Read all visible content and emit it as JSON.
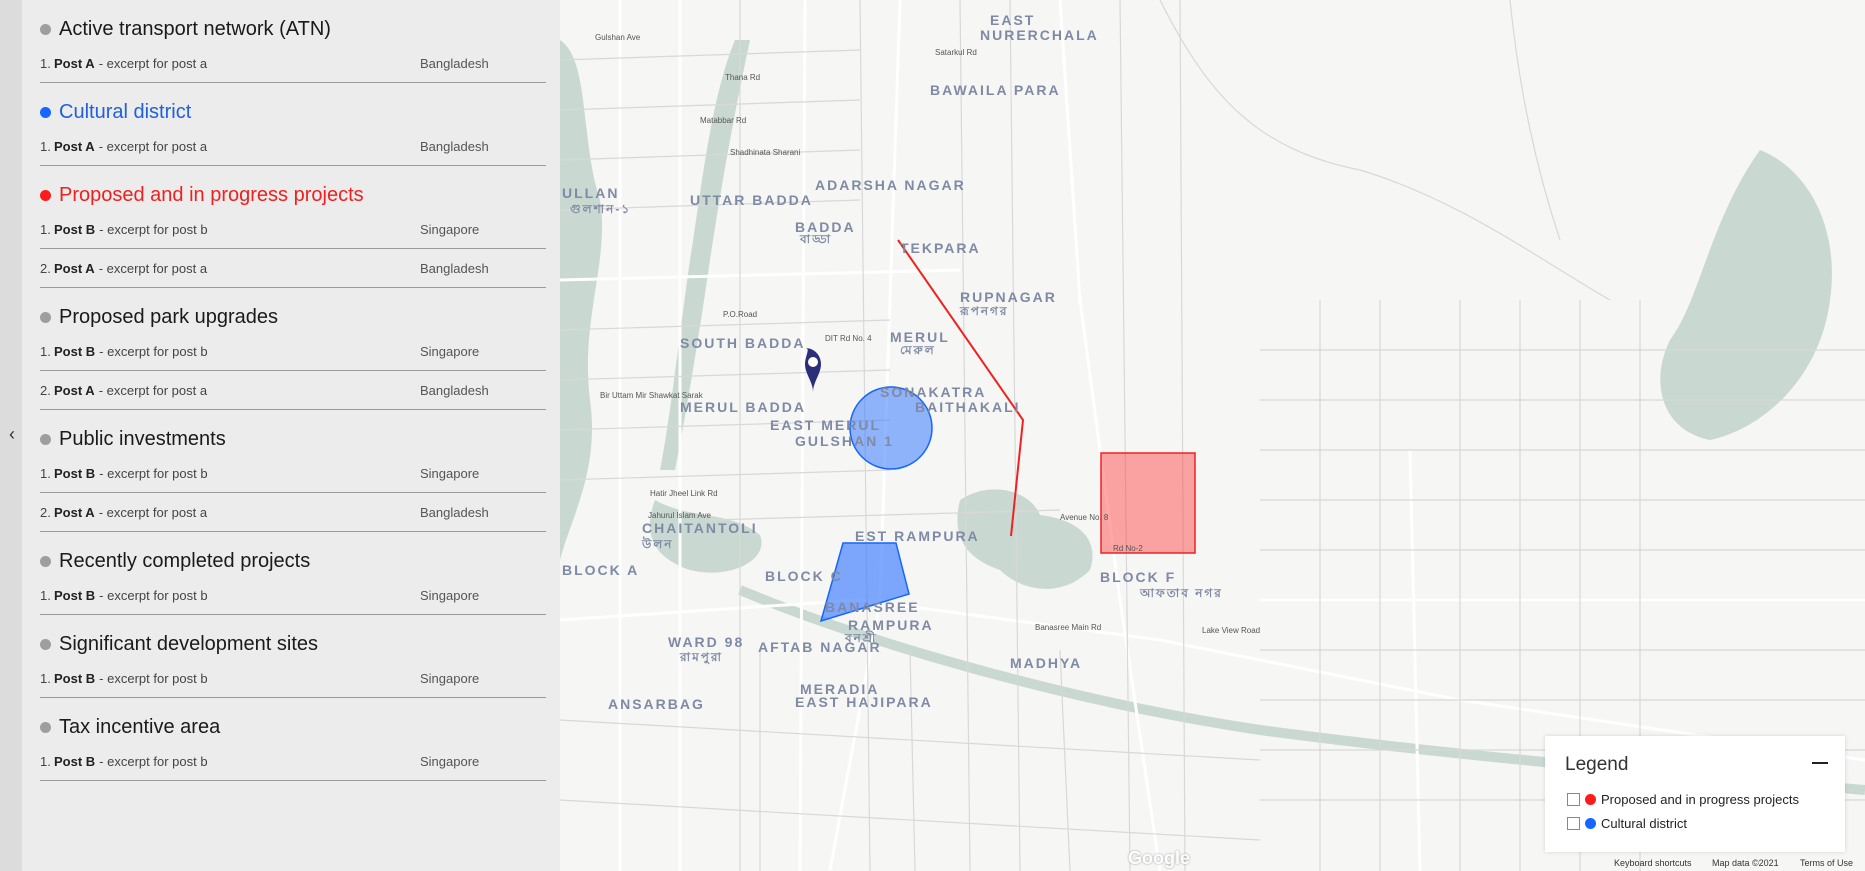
{
  "sidebar": {
    "collapse_icon": "chevron-left-icon",
    "sections": [
      {
        "title": "Active transport network (ATN)",
        "color": "#9e9e9e",
        "title_color": "#1a1a1a",
        "posts": [
          {
            "num": "1.",
            "title": "Post A",
            "excerpt": "- excerpt for post a",
            "country": "Bangladesh"
          }
        ]
      },
      {
        "title": "Cultural district",
        "color": "#1565ff",
        "title_color": "#1f5fe0",
        "posts": [
          {
            "num": "1.",
            "title": "Post A",
            "excerpt": "- excerpt for post a",
            "country": "Bangladesh"
          }
        ]
      },
      {
        "title": "Proposed and in progress projects",
        "color": "#ff1a1a",
        "title_color": "#ee2020",
        "posts": [
          {
            "num": "1.",
            "title": "Post B",
            "excerpt": "- excerpt for post b",
            "country": "Singapore"
          },
          {
            "num": "2.",
            "title": "Post A",
            "excerpt": "- excerpt for post a",
            "country": "Bangladesh"
          }
        ]
      },
      {
        "title": "Proposed park upgrades",
        "color": "#9e9e9e",
        "title_color": "#1a1a1a",
        "posts": [
          {
            "num": "1.",
            "title": "Post B",
            "excerpt": "- excerpt for post b",
            "country": "Singapore"
          },
          {
            "num": "2.",
            "title": "Post A",
            "excerpt": "- excerpt for post a",
            "country": "Bangladesh"
          }
        ]
      },
      {
        "title": "Public investments",
        "color": "#9e9e9e",
        "title_color": "#1a1a1a",
        "posts": [
          {
            "num": "1.",
            "title": "Post B",
            "excerpt": "- excerpt for post b",
            "country": "Singapore"
          },
          {
            "num": "2.",
            "title": "Post A",
            "excerpt": "- excerpt for post a",
            "country": "Bangladesh"
          }
        ]
      },
      {
        "title": "Recently completed projects",
        "color": "#9e9e9e",
        "title_color": "#1a1a1a",
        "posts": [
          {
            "num": "1.",
            "title": "Post B",
            "excerpt": "- excerpt for post b",
            "country": "Singapore"
          }
        ]
      },
      {
        "title": "Significant development sites",
        "color": "#9e9e9e",
        "title_color": "#1a1a1a",
        "posts": [
          {
            "num": "1.",
            "title": "Post B",
            "excerpt": "- excerpt for post b",
            "country": "Singapore"
          }
        ]
      },
      {
        "title": "Tax incentive area",
        "color": "#9e9e9e",
        "title_color": "#1a1a1a",
        "posts": [
          {
            "num": "1.",
            "title": "Post B",
            "excerpt": "- excerpt for post b",
            "country": "Singapore"
          }
        ]
      }
    ]
  },
  "map": {
    "area_labels": [
      "EAST",
      "NURERCHALA",
      "BAWAILA PARA",
      "ADARSHA NAGAR",
      "UTTAR BADDA",
      "BADDA",
      "TEKPARA",
      "RUPNAGAR",
      "MERUL",
      "SOUTH BADDA",
      "SONAKATRA",
      "BAITHAKALI",
      "MERUL BADDA",
      "EAST MERUL",
      "GULSHAN 1",
      "ULLAN",
      "CHAITANTOLI",
      "EST RAMPURA",
      "BLOCK A",
      "BLOCK C",
      "BANASREE",
      "RAMPURA",
      "WARD 98",
      "AFTAB NAGAR",
      "BLOCK F",
      "MADHYA",
      "MERADIA",
      "EAST HAJIPARA",
      "ANSARBAG"
    ],
    "road_labels": [
      "Satarkul Rd",
      "Thana Rd",
      "Matabbar Rd",
      "Shadhinata Sharani",
      "P.O.Road",
      "DIT Rd No. 4",
      "Hatir Jheel Link Rd",
      "Jahurul Islam Ave",
      "Banasree Main Rd",
      "Rd No-2",
      "Lake View Road",
      "Bir Uttam Mir Shawkat Sarak",
      "Gulshan Ave",
      "Avenue No. 8"
    ],
    "local_labels": [
      "বাড্ডা",
      "মেরুল",
      "রূপনগর",
      "উলন",
      "গুলশান-১",
      "বনশ্রী",
      "রামপুরা",
      "আফতাব নগর"
    ],
    "marker_icon": "map-pin-icon",
    "feature_colors": {
      "proposed": "#ff3b3b",
      "cultural": "#3b7bff"
    },
    "google_logo": "Google"
  },
  "legend": {
    "title": "Legend",
    "minimize_icon": "minus-icon",
    "items": [
      {
        "label": "Proposed and in progress projects",
        "color": "#ff1a1a",
        "checked": false
      },
      {
        "label": "Cultural district",
        "color": "#1565ff",
        "checked": false
      }
    ]
  },
  "attribution": {
    "shortcuts": "Keyboard shortcuts",
    "data": "Map data ©2021",
    "terms": "Terms of Use"
  }
}
